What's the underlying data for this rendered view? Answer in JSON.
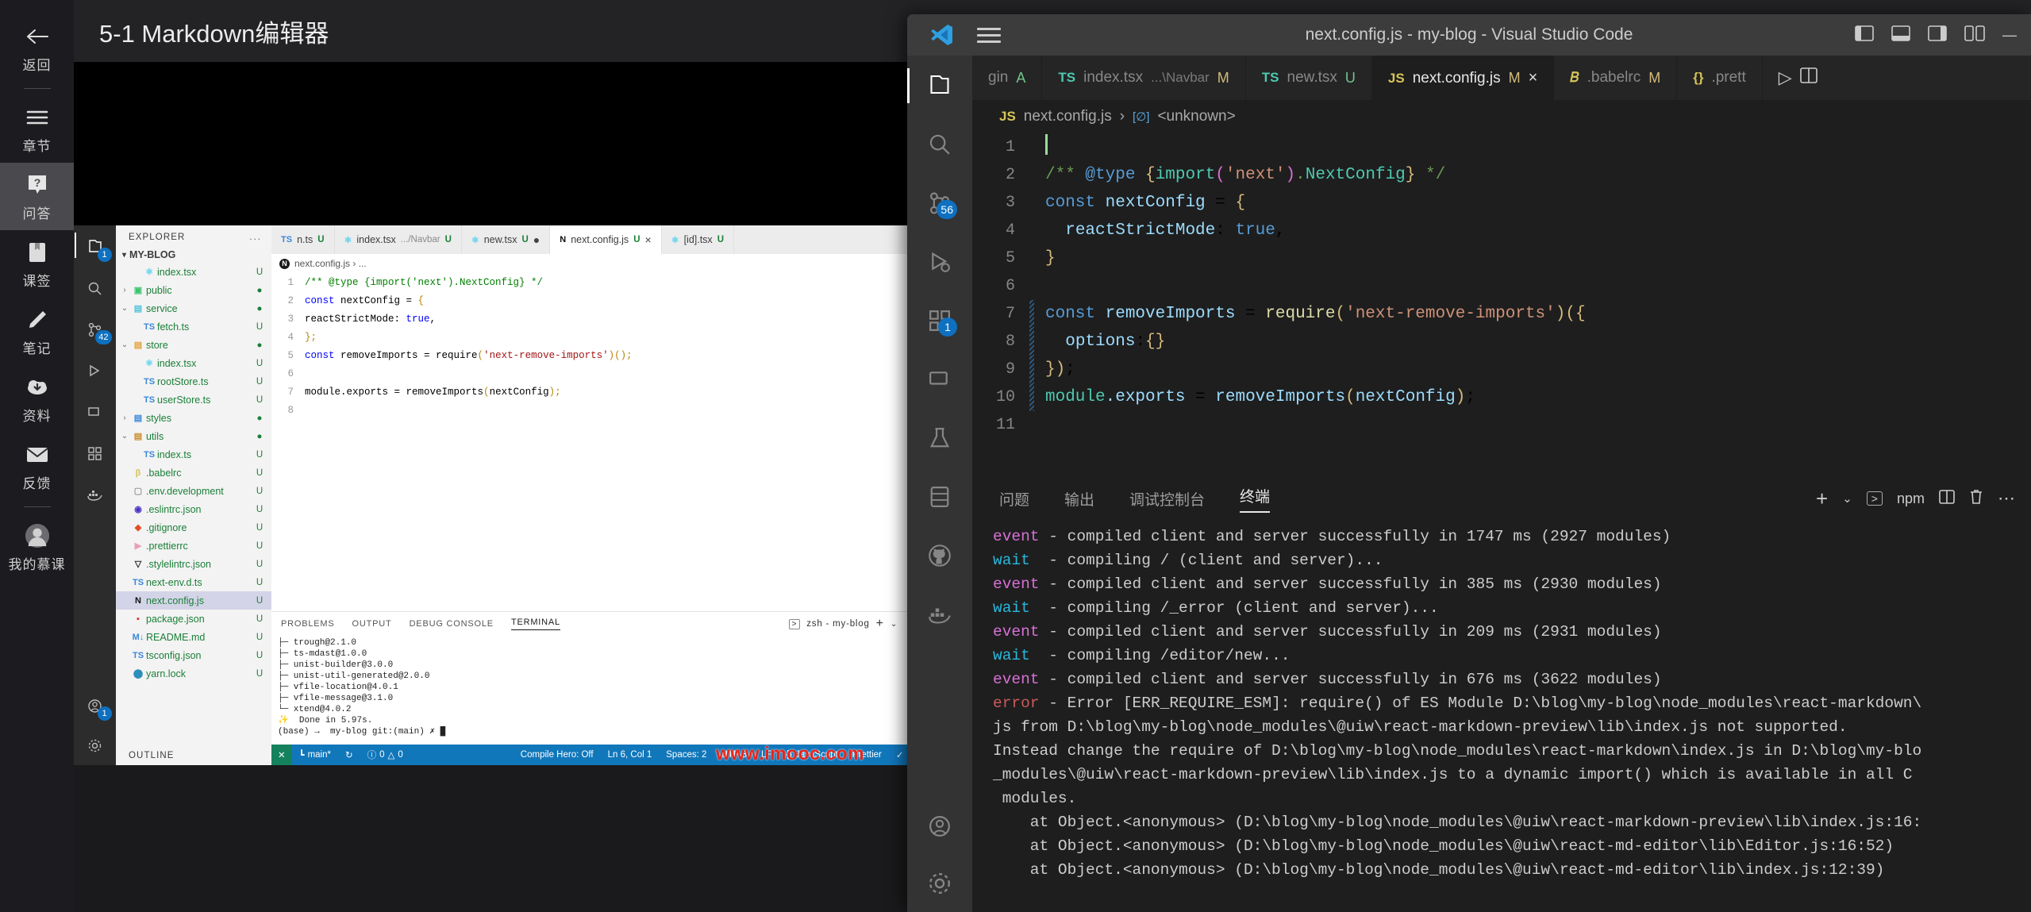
{
  "imooc": {
    "header_title": "5-1 Markdown编辑器",
    "sidebar": [
      {
        "label": "返回",
        "icon": "back-arrow-icon"
      },
      {
        "label": "章节",
        "icon": "menu-icon"
      },
      {
        "label": "问答",
        "icon": "question-icon"
      },
      {
        "label": "课签",
        "icon": "bookmark-icon"
      },
      {
        "label": "笔记",
        "icon": "pencil-icon"
      },
      {
        "label": "资料",
        "icon": "download-cloud-icon"
      },
      {
        "label": "反馈",
        "icon": "envelope-icon"
      },
      {
        "label": "我的慕课",
        "icon": "avatar-icon"
      }
    ]
  },
  "vscode_back": {
    "explorer": {
      "title": "EXPLORER",
      "more": "...",
      "root": "MY-BLOG",
      "files": [
        {
          "chev": "",
          "icon": "react",
          "name": "index.tsx",
          "status": "U",
          "indent": 2
        },
        {
          "chev": "›",
          "icon": "public",
          "name": "public",
          "status": "●",
          "indent": 1
        },
        {
          "chev": "⌄",
          "icon": "service",
          "name": "service",
          "status": "●",
          "indent": 1
        },
        {
          "chev": "",
          "icon": "ts",
          "name": "fetch.ts",
          "status": "U",
          "indent": 2
        },
        {
          "chev": "⌄",
          "icon": "store",
          "name": "store",
          "status": "●",
          "indent": 1
        },
        {
          "chev": "",
          "icon": "react",
          "name": "index.tsx",
          "status": "U",
          "indent": 2
        },
        {
          "chev": "",
          "icon": "ts",
          "name": "rootStore.ts",
          "status": "U",
          "indent": 2
        },
        {
          "chev": "",
          "icon": "ts",
          "name": "userStore.ts",
          "status": "U",
          "indent": 2
        },
        {
          "chev": "›",
          "icon": "styles",
          "name": "styles",
          "status": "●",
          "indent": 1
        },
        {
          "chev": "⌄",
          "icon": "utils",
          "name": "utils",
          "status": "●",
          "indent": 1
        },
        {
          "chev": "",
          "icon": "ts",
          "name": "index.ts",
          "status": "U",
          "indent": 2
        },
        {
          "chev": "",
          "icon": "babel",
          "name": ".babelrc",
          "status": "U",
          "indent": 1
        },
        {
          "chev": "",
          "icon": "file",
          "name": ".env.development",
          "status": "U",
          "indent": 1
        },
        {
          "chev": "",
          "icon": "eslint",
          "name": ".eslintrc.json",
          "status": "U",
          "indent": 1
        },
        {
          "chev": "",
          "icon": "git",
          "name": ".gitignore",
          "status": "U",
          "indent": 1
        },
        {
          "chev": "",
          "icon": "prettier",
          "name": ".prettierrc",
          "status": "U",
          "indent": 1
        },
        {
          "chev": "",
          "icon": "stylelint",
          "name": ".stylelintrc.json",
          "status": "U",
          "indent": 1
        },
        {
          "chev": "",
          "icon": "ts",
          "name": "next-env.d.ts",
          "status": "U",
          "indent": 1
        },
        {
          "chev": "",
          "icon": "next",
          "name": "next.config.js",
          "status": "U",
          "indent": 1,
          "selected": true
        },
        {
          "chev": "",
          "icon": "npm",
          "name": "package.json",
          "status": "U",
          "indent": 1
        },
        {
          "chev": "",
          "icon": "md",
          "name": "README.md",
          "status": "U",
          "indent": 1
        },
        {
          "chev": "",
          "icon": "ts",
          "name": "tsconfig.json",
          "status": "U",
          "indent": 1
        },
        {
          "chev": "",
          "icon": "yarn",
          "name": "yarn.lock",
          "status": "U",
          "indent": 1
        }
      ],
      "outline": "OUTLINE"
    },
    "tabs": [
      {
        "icon": "ts",
        "label": "n.ts",
        "sub": "",
        "status": "U",
        "active": false
      },
      {
        "icon": "react",
        "label": "index.tsx",
        "sub": ".../Navbar",
        "status": "U",
        "active": false
      },
      {
        "icon": "react",
        "label": "new.tsx",
        "sub": "",
        "status": "U",
        "dirty": true,
        "active": false
      },
      {
        "icon": "next",
        "label": "next.config.js",
        "sub": "",
        "status": "U",
        "active": true,
        "close": "×"
      },
      {
        "icon": "react",
        "label": "[id].tsx",
        "sub": "",
        "status": "U",
        "active": false
      }
    ],
    "breadcrumb": "next.config.js › ...",
    "code": [
      {
        "n": "1",
        "text": "/** @type {import('next').NextConfig} */"
      },
      {
        "n": "2",
        "text": "const nextConfig = {"
      },
      {
        "n": "3",
        "text": "  reactStrictMode: true,"
      },
      {
        "n": "4",
        "text": "};"
      },
      {
        "n": "5",
        "text": "const removeImports = require('next-remove-imports')();"
      },
      {
        "n": "6",
        "text": ""
      },
      {
        "n": "7",
        "text": "module.exports = removeImports(nextConfig);"
      },
      {
        "n": "8",
        "text": ""
      }
    ],
    "panel_tabs": [
      "PROBLEMS",
      "OUTPUT",
      "DEBUG CONSOLE",
      "TERMINAL"
    ],
    "panel_active": "TERMINAL",
    "panel_right": {
      "shell": "zsh - my-blog",
      "plus": "+",
      "chev": "⌄"
    },
    "terminal": [
      "├─ trough@2.1.0",
      "├─ ts-mdast@1.0.0",
      "├─ unist-builder@3.0.0",
      "├─ unist-util-generated@2.0.0",
      "├─ vfile-location@4.0.1",
      "├─ vfile-message@3.1.0",
      "└─ xtend@4.0.2",
      "✨  Done in 5.97s.",
      "(base) →  my-blog git:(main) ✗ █"
    ],
    "status": {
      "remote": "✕",
      "branch": "main*",
      "sync": "↻",
      "errors": "0",
      "warnings": "0",
      "compile_hero": "Compile Hero: Off",
      "position": "Ln 6, Col 1",
      "spaces": "Spaces: 2",
      "encoding": "UTF-8",
      "eol": "LF",
      "language": "JavaScript",
      "prettier": "Prettier",
      "bell": "✓"
    },
    "watermark": "www.imooc.com"
  },
  "vscode_front": {
    "window_title": "next.config.js - my-blog - Visual Studio Code",
    "tabs": [
      {
        "icon": "",
        "label": "gin",
        "status": "A",
        "status_color": "#72c58a",
        "active": false
      },
      {
        "icon": "TS",
        "icon_color": "#4ec9b0",
        "label": "index.tsx",
        "sub": "...\\Navbar",
        "status": "M",
        "status_color": "#d4bb7a",
        "active": false
      },
      {
        "icon": "TS",
        "icon_color": "#4ec9b0",
        "label": "new.tsx",
        "sub": "",
        "status": "U",
        "status_color": "#72c58a",
        "active": false
      },
      {
        "icon": "JS",
        "icon_color": "#d7c456",
        "label": "next.config.js",
        "sub": "",
        "status": "M",
        "status_color": "#d4bb7a",
        "active": true,
        "close": "×"
      },
      {
        "icon": "𝐵",
        "icon_color": "#d7c456",
        "label": ".babelrc",
        "sub": "",
        "status": "M",
        "status_color": "#d4bb7a",
        "active": false
      },
      {
        "icon": "{}",
        "icon_color": "#d7c456",
        "label": ".prett",
        "sub": "",
        "status": "",
        "active": false
      }
    ],
    "tab_actions": {
      "run": "▷",
      "split": "⬚"
    },
    "breadcrumb": {
      "icon": "JS",
      "file": "next.config.js",
      "sep": "›",
      "symbol_icon": "[∅]",
      "symbol": "<unknown>"
    },
    "code": [
      {
        "n": "1",
        "text": "",
        "cursor": true,
        "dirty": false
      },
      {
        "n": "2",
        "text": "/** @type {import('next').NextConfig} */",
        "dirty": false
      },
      {
        "n": "3",
        "text": "const nextConfig = {",
        "dirty": false
      },
      {
        "n": "4",
        "text": "  reactStrictMode: true,",
        "dirty": false
      },
      {
        "n": "5",
        "text": "}",
        "dirty": false
      },
      {
        "n": "6",
        "text": "",
        "dirty": false
      },
      {
        "n": "7",
        "text": "const removeImports = require('next-remove-imports')({",
        "dirty": true
      },
      {
        "n": "8",
        "text": "  options:{}",
        "dirty": true
      },
      {
        "n": "9",
        "text": "});",
        "dirty": true
      },
      {
        "n": "10",
        "text": "module.exports = removeImports(nextConfig);",
        "dirty": true
      },
      {
        "n": "11",
        "text": "",
        "dirty": false
      }
    ],
    "panel_tabs": [
      "问题",
      "输出",
      "调试控制台",
      "终端"
    ],
    "panel_active": "终端",
    "panel_right": {
      "plus": "+",
      "chev": "⌄",
      "shell": "npm",
      "split": "⬚",
      "trash": "Ὕ1",
      "more": "⋯"
    },
    "terminal_lines": [
      {
        "tag": "event",
        "tag_class": "c-ev",
        "text": " - compiled client and server successfully in 1747 ms (2927 modules)"
      },
      {
        "tag": "wait ",
        "tag_class": "c-wait",
        "text": " - compiling / (client and server)..."
      },
      {
        "tag": "event",
        "tag_class": "c-ev",
        "text": " - compiled client and server successfully in 385 ms (2930 modules)"
      },
      {
        "tag": "wait ",
        "tag_class": "c-wait",
        "text": " - compiling /_error (client and server)..."
      },
      {
        "tag": "event",
        "tag_class": "c-ev",
        "text": " - compiled client and server successfully in 209 ms (2931 modules)"
      },
      {
        "tag": "wait ",
        "tag_class": "c-wait",
        "text": " - compiling /editor/new..."
      },
      {
        "tag": "event",
        "tag_class": "c-ev",
        "text": " - compiled client and server successfully in 676 ms (3622 modules)"
      },
      {
        "tag": "error",
        "tag_class": "c-err",
        "text": " - Error [ERR_REQUIRE_ESM]: require() of ES Module D:\\blog\\my-blog\\node_modules\\react-markdown\\"
      },
      {
        "tag": "",
        "tag_class": "",
        "text": "js from D:\\blog\\my-blog\\node_modules\\@uiw\\react-markdown-preview\\lib\\index.js not supported."
      },
      {
        "tag": "",
        "tag_class": "",
        "text": "Instead change the require of D:\\blog\\my-blog\\node_modules\\react-markdown\\index.js in D:\\blog\\my-blo"
      },
      {
        "tag": "",
        "tag_class": "",
        "text": "_modules\\@uiw\\react-markdown-preview\\lib\\index.js to a dynamic import() which is available in all C"
      },
      {
        "tag": "",
        "tag_class": "",
        "text": " modules."
      },
      {
        "tag": "",
        "tag_class": "",
        "text": "    at Object.<anonymous> (D:\\blog\\my-blog\\node_modules\\@uiw\\react-markdown-preview\\lib\\index.js:16:"
      },
      {
        "tag": "",
        "tag_class": "",
        "text": "    at Object.<anonymous> (D:\\blog\\my-blog\\node_modules\\@uiw\\react-md-editor\\lib\\Editor.js:16:52)"
      },
      {
        "tag": "",
        "tag_class": "",
        "text": "    at Object.<anonymous> (D:\\blog\\my-blog\\node_modules\\@uiw\\react-md-editor\\lib\\index.js:12:39)"
      }
    ],
    "activity_badges": {
      "source_control": "56",
      "extensions": "1"
    },
    "window_controls": {
      "panel_left": "⬚",
      "panel_bottom": "⬚",
      "panel_right": "⬚",
      "layout": "⬚",
      "minimize": "—"
    }
  },
  "colors": {
    "accent_blue": "#0e70c0",
    "status_bar": "#1177bb",
    "remote_green": "#16825d",
    "watermark_red": "#e8241a"
  }
}
